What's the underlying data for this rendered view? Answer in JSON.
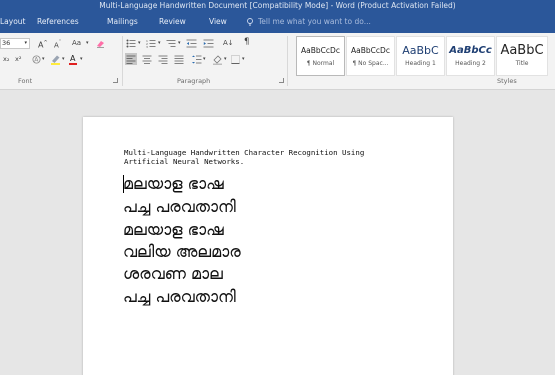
{
  "window": {
    "title": "Multi-Language Handwritten Document [Compatibility Mode] - Word (Product Activation Failed)"
  },
  "tabs": [
    {
      "label": "Layout"
    },
    {
      "label": "References"
    },
    {
      "label": "Mailings"
    },
    {
      "label": "Review"
    },
    {
      "label": "View"
    }
  ],
  "tell_me": {
    "placeholder": "Tell me what you want to do..."
  },
  "ribbon": {
    "font_size_value": "36",
    "grow_font_label": "A",
    "shrink_font_label": "A",
    "change_case_label": "Aa",
    "font_color_label": "A",
    "highlight_color": "#ffeb3b",
    "font_color": "#e02020",
    "pilcrow_label": "¶",
    "sort_label": "A↓",
    "font_group_label": "Font",
    "paragraph_group_label": "Paragraph",
    "styles_group_label": "Styles"
  },
  "styles": [
    {
      "sample": "AaBbCcDc",
      "name": "¶ Normal"
    },
    {
      "sample": "AaBbCcDc",
      "name": "¶ No Spac..."
    },
    {
      "sample": "AaBbC",
      "name": "Heading 1"
    },
    {
      "sample": "AaBbCc",
      "name": "Heading 2"
    },
    {
      "sample": "AaBbC",
      "name": "Title"
    }
  ],
  "document": {
    "heading_line1": "Multi-Language Handwritten Character Recognition Using",
    "heading_line2": "Artificial Neural Networks.",
    "lines": [
      "മലയാള ഭാഷ",
      "പച്ച പരവതാനി",
      "മലയാള ഭാഷ",
      "വലിയ അലമാര",
      "ശരവണ മാല",
      "പച്ച പരവതാനി"
    ]
  }
}
